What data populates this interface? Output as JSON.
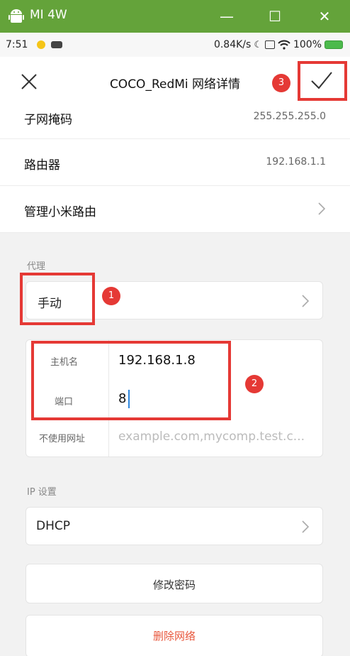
{
  "window": {
    "title": "MI 4W",
    "min": "—",
    "max": "☐",
    "close": "✕"
  },
  "status": {
    "time": "7:51",
    "speed": "0.84K/s",
    "battery": "100%"
  },
  "header": {
    "title": "COCO_RedMi 网络详情"
  },
  "rows": {
    "subnet": {
      "label": "子网掩码",
      "value": "255.255.255.0"
    },
    "router": {
      "label": "路由器",
      "value": "192.168.1.1"
    },
    "manage": {
      "label": "管理小米路由"
    }
  },
  "proxy": {
    "section_label": "代理",
    "mode": "手动",
    "host_label": "主机名",
    "host_value": "192.168.1.8",
    "port_label": "端口",
    "port_value": "8",
    "bypass_label": "不使用网址",
    "bypass_placeholder": "example.com,mycomp.test.c..."
  },
  "ip": {
    "section_label": "IP 设置",
    "mode": "DHCP"
  },
  "buttons": {
    "modify": "修改密码",
    "delete": "删除网络"
  },
  "badges": [
    "1",
    "2",
    "3"
  ],
  "colors": {
    "titlebar": "#64a33a",
    "highlight": "#e53935",
    "delete": "#e8573c"
  }
}
